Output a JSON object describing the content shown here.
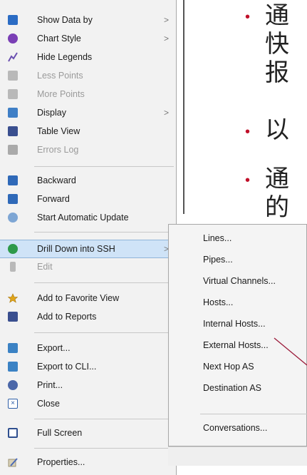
{
  "slide": {
    "bullets": [
      {
        "lines": [
          "通",
          "快",
          "报"
        ]
      },
      {
        "lines": [
          "以"
        ]
      },
      {
        "lines": [
          "通",
          "的"
        ]
      }
    ],
    "accent_color": "#c0102a",
    "callout_color": "#9b1b3a"
  },
  "menu": {
    "items": [
      {
        "label": "Show Data by",
        "icon": "show-data-icon",
        "submenu": true,
        "disabled": false
      },
      {
        "label": "Chart Style",
        "icon": "chart-style-icon",
        "submenu": true,
        "disabled": false
      },
      {
        "label": "Hide Legends",
        "icon": "hide-legends-icon",
        "submenu": false,
        "disabled": false
      },
      {
        "label": "Less Points",
        "icon": "less-points-icon",
        "submenu": false,
        "disabled": true
      },
      {
        "label": "More Points",
        "icon": "more-points-icon",
        "submenu": false,
        "disabled": true
      },
      {
        "label": "Display",
        "icon": "display-icon",
        "submenu": true,
        "disabled": false
      },
      {
        "label": "Table View",
        "icon": "table-view-icon",
        "submenu": false,
        "disabled": false
      },
      {
        "label": "Errors Log",
        "icon": "errors-log-icon",
        "submenu": false,
        "disabled": true
      },
      {
        "label": "Backward",
        "icon": "backward-icon",
        "submenu": false,
        "disabled": false
      },
      {
        "label": "Forward",
        "icon": "forward-icon",
        "submenu": false,
        "disabled": false
      },
      {
        "label": "Start Automatic Update",
        "icon": "auto-update-icon",
        "submenu": false,
        "disabled": false
      },
      {
        "label": "Drill Down into SSH",
        "icon": "drill-down-icon",
        "submenu": true,
        "disabled": false,
        "highlighted": true
      },
      {
        "label": "Edit",
        "icon": "edit-icon",
        "submenu": false,
        "disabled": true
      },
      {
        "label": "Add to Favorite View",
        "icon": "favorite-icon",
        "submenu": false,
        "disabled": false
      },
      {
        "label": "Add to Reports",
        "icon": "reports-icon",
        "submenu": false,
        "disabled": false
      },
      {
        "label": "Export...",
        "icon": "export-icon",
        "submenu": false,
        "disabled": false
      },
      {
        "label": "Export to CLI...",
        "icon": "export-cli-icon",
        "submenu": false,
        "disabled": false
      },
      {
        "label": "Print...",
        "icon": "print-icon",
        "submenu": false,
        "disabled": false
      },
      {
        "label": "Close",
        "icon": "close-icon",
        "submenu": false,
        "disabled": false
      },
      {
        "label": "Full Screen",
        "icon": "full-screen-icon",
        "submenu": false,
        "disabled": false
      },
      {
        "label": "Properties...",
        "icon": "properties-icon",
        "submenu": false,
        "disabled": false
      }
    ],
    "highlight_color": "#cfe3f7"
  },
  "submenu": {
    "items": [
      {
        "label": "Lines..."
      },
      {
        "label": "Pipes..."
      },
      {
        "label": "Virtual Channels..."
      },
      {
        "label": "Hosts..."
      },
      {
        "label": "Internal Hosts..."
      },
      {
        "label": "External Hosts..."
      },
      {
        "label": "Next Hop AS"
      },
      {
        "label": "Destination AS"
      },
      {
        "label": "Conversations..."
      }
    ]
  }
}
